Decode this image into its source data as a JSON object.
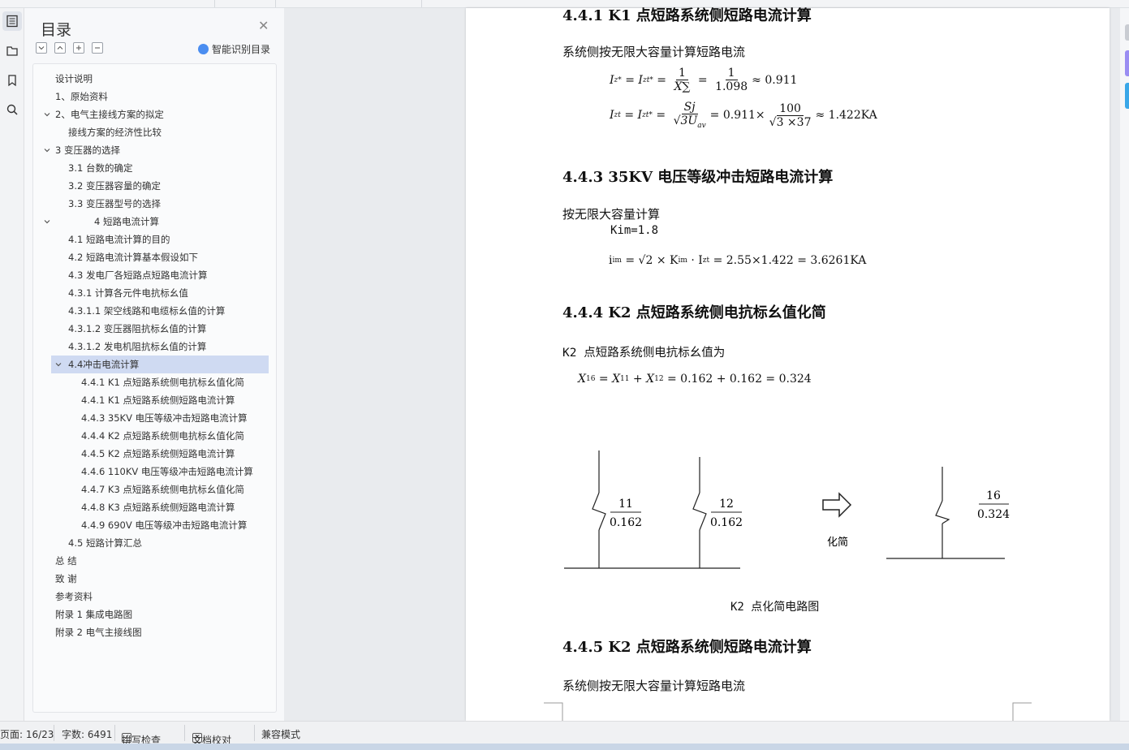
{
  "toc": {
    "title": "目录",
    "smart_label": "智能识别目录",
    "items": [
      {
        "label": "设计说明",
        "level": 0,
        "chev": ""
      },
      {
        "label": "1、原始资料",
        "level": 0,
        "chev": ""
      },
      {
        "label": "2、电气主接线方案的拟定",
        "level": 0,
        "chev": "v"
      },
      {
        "label": "接线方案的经济性比较",
        "level": 1,
        "chev": ""
      },
      {
        "label": "3  变压器的选择",
        "level": 0,
        "chev": "v"
      },
      {
        "label": "3.1  台数的确定",
        "level": 1,
        "chev": ""
      },
      {
        "label": "3.2  变压器容量的确定",
        "level": 1,
        "chev": ""
      },
      {
        "label": "3.3    变压器型号的选择",
        "level": 1,
        "chev": ""
      },
      {
        "label": "4  短路电流计算",
        "level": 3,
        "chev": "v"
      },
      {
        "label": "4.1 短路电流计算的目的",
        "level": 1,
        "chev": ""
      },
      {
        "label": "4.2 短路电流计算基本假设如下",
        "level": 1,
        "chev": ""
      },
      {
        "label": "4.3 发电厂各短路点短路电流计算",
        "level": 1,
        "chev": ""
      },
      {
        "label": "4.3.1  计算各元件电抗标幺值",
        "level": 1,
        "chev": ""
      },
      {
        "label": "4.3.1.1  架空线路和电缆标幺值的计算",
        "level": 1,
        "chev": ""
      },
      {
        "label": "4.3.1.2  变压器阻抗标幺值的计算",
        "level": 1,
        "chev": ""
      },
      {
        "label": "4.3.1.2  发电机阻抗标幺值的计算",
        "level": 1,
        "chev": ""
      },
      {
        "label": "4.4冲击电流计算",
        "level": 1,
        "chev": "v",
        "selected": true
      },
      {
        "label": "4.4.1    K1 点短路系统侧电抗标幺值化简",
        "level": 2,
        "chev": ""
      },
      {
        "label": "4.4.1    K1 点短路系统侧短路电流计算",
        "level": 2,
        "chev": ""
      },
      {
        "label": "4.4.3 35KV 电压等级冲击短路电流计算",
        "level": 2,
        "chev": ""
      },
      {
        "label": "4.4.4 K2 点短路系统侧电抗标幺值化简",
        "level": 2,
        "chev": ""
      },
      {
        "label": "4.4.5 K2 点短路系统侧短路电流计算",
        "level": 2,
        "chev": ""
      },
      {
        "label": "4.4.6 110KV 电压等级冲击短路电流计算",
        "level": 2,
        "chev": ""
      },
      {
        "label": "4.4.7 K3 点短路系统侧电抗标幺值化简",
        "level": 2,
        "chev": ""
      },
      {
        "label": "4.4.8 K3 点短路系统侧短路电流计算",
        "level": 2,
        "chev": ""
      },
      {
        "label": "4.4.9 690V 电压等级冲击短路电流计算",
        "level": 2,
        "chev": ""
      },
      {
        "label": "4.5 短路计算汇总",
        "level": 1,
        "chev": ""
      },
      {
        "label": "总  结",
        "level": 0,
        "chev": ""
      },
      {
        "label": "致    谢",
        "level": 0,
        "chev": ""
      },
      {
        "label": "参考资料",
        "level": 0,
        "chev": ""
      },
      {
        "label": "附录 1  集成电路图",
        "level": 0,
        "chev": ""
      },
      {
        "label": "附录 2  电气主接线图",
        "level": 0,
        "chev": ""
      }
    ]
  },
  "doc": {
    "h1": "4.4.1    K1 点短路系统侧短路电流计算",
    "p1": "系统侧按无限大容量计算短路电流",
    "eq1": {
      "lhs": "I",
      "lhs_sub": "z*",
      "eq_b": "I",
      "eq_b_sub": "zt*",
      "n1": "1",
      "d1": "X∑",
      "n2": "1",
      "d2": "1.098",
      "res": "≈ 0.911"
    },
    "eq2": {
      "lhs": "I",
      "lhs_sub": "zt",
      "eq_b": "I",
      "eq_b_sub": "zt*",
      "n1": "Sj",
      "d1": "√3U",
      "d1_sub": "av",
      "mid": "= 0.911×",
      "n2": "100",
      "d2": "√3 ×37",
      "res": "≈ 1.422KA"
    },
    "h2": "4.4.3 35KV 电压等级冲击短路电流计算",
    "p2": "按无限大容量计算",
    "kim": "Kim=1.8",
    "eq3": "= √2 × K",
    "eq3_lhs": "i",
    "eq3_lhs_sub": "im",
    "eq3_k_sub": "im",
    "eq3_i": "· I",
    "eq3_i_sub": "zt",
    "eq3_res": "= 2.55×1.422 = 3.6261KA",
    "h3": "4.4.4 K2 点短路系统侧电抗标幺值化简",
    "p3": "K2 点短路系统侧电抗标幺值为",
    "eq4_lhs": "X",
    "eq4_lhs_sub": "16",
    "eq4_a": "X",
    "eq4_a_sub": "11",
    "eq4_b": "X",
    "eq4_b_sub": "12",
    "eq4_res": "= 0.162 + 0.162 = 0.324",
    "circuit": {
      "b1_num": "11",
      "b1_val": "0.162",
      "b2_num": "12",
      "b2_val": "0.162",
      "b3_num": "16",
      "b3_val": "0.324",
      "arrow_label": "化简"
    },
    "caption": "K2 点化简电路图",
    "h4": "4.4.5 K2 点短路系统侧短路电流计算",
    "p4": "系统侧按无限大容量计算短路电流"
  },
  "status": {
    "page": "页面: 16/23",
    "words": "字数: 6491",
    "spell": "拼写检查",
    "proof": "文档校对",
    "compat": "兼容模式"
  },
  "colors": {
    "accent": "#4a8df0",
    "selected": "#cfdaf2",
    "purple_tab": "#9a8df2",
    "blue_tab": "#3aa7e8"
  }
}
